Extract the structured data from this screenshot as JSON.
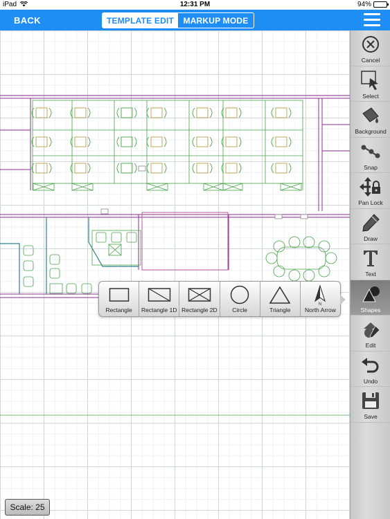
{
  "status_bar": {
    "device": "iPad",
    "time": "12:31 PM",
    "battery": "94%",
    "battery_level": 0.94,
    "wifi_icon": "wifi-icon"
  },
  "nav": {
    "back_label": "BACK",
    "segments": [
      {
        "label": "TEMPLATE EDIT",
        "selected": true
      },
      {
        "label": "MARKUP MODE",
        "selected": false
      }
    ],
    "menu_icon": "hamburger-menu-icon",
    "accent_color": "#1e8ef5"
  },
  "tools": [
    {
      "label": "Cancel",
      "icon": "cancel-icon"
    },
    {
      "label": "Select",
      "icon": "select-cursor-icon"
    },
    {
      "label": "Background",
      "icon": "paint-bucket-icon"
    },
    {
      "label": "Snap",
      "icon": "snap-icon"
    },
    {
      "label": "Pan Lock",
      "icon": "pan-lock-icon"
    },
    {
      "label": "Draw",
      "icon": "pencil-icon"
    },
    {
      "label": "Text",
      "icon": "text-icon"
    },
    {
      "label": "Shapes",
      "icon": "shapes-icon",
      "active": true
    },
    {
      "label": "Edit",
      "icon": "edit-icon"
    },
    {
      "label": "Undo",
      "icon": "undo-icon"
    },
    {
      "label": "Save",
      "icon": "save-icon"
    }
  ],
  "shapes_popover": [
    {
      "label": "Rectangle",
      "icon": "rectangle-icon"
    },
    {
      "label": "Rectangle 1D",
      "icon": "rectangle-1d-icon"
    },
    {
      "label": "Rectangle 2D",
      "icon": "rectangle-2d-icon"
    },
    {
      "label": "Circle",
      "icon": "circle-icon"
    },
    {
      "label": "Triangle",
      "icon": "triangle-icon"
    },
    {
      "label": "North Arrow",
      "icon": "north-arrow-icon"
    }
  ],
  "north_arrow_letter": "N",
  "scale": "Scale: 25"
}
